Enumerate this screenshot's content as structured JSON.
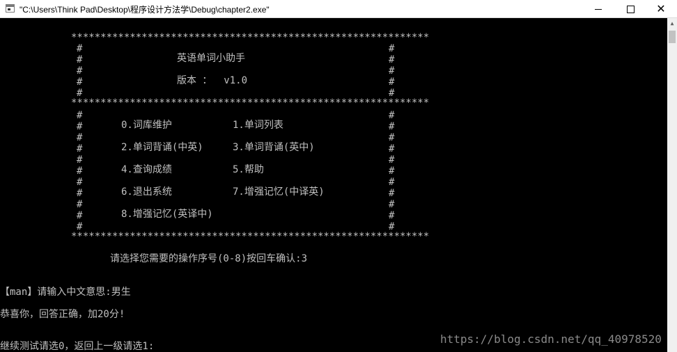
{
  "window": {
    "title": "\"C:\\Users\\Think Pad\\Desktop\\程序设计方法学\\Debug\\chapter2.exe\"",
    "minimize_icon": "minimize-icon",
    "maximize_icon": "maximize-icon",
    "close_icon": "close-icon",
    "close_glyph": "✕"
  },
  "console": {
    "border_stars": "*************************************************************",
    "hash": "#",
    "app_title": "英语单词小助手",
    "version": "版本 ：  v1.0",
    "menu": [
      "0.词库维护",
      "1.单词列表",
      "2.单词背诵(中英)",
      "3.单词背诵(英中)",
      "4.查询成绩",
      "5.帮助",
      "6.退出系统",
      "7.增强记忆(中译英)",
      "8.增强记忆(英译中)"
    ],
    "prompt": "请选择您需要的操作序号(0-8)按回车确认:3",
    "question": "【man】请输入中文意思:男生",
    "result": "恭喜你，回答正确，加20分!",
    "next": "继续测试请选0，返回上一级请选1:"
  },
  "watermark": "https://blog.csdn.net/qq_40978520"
}
